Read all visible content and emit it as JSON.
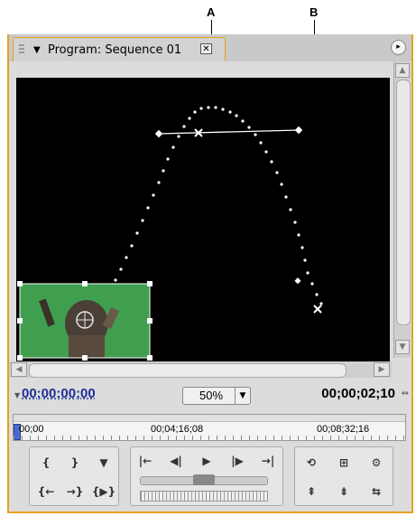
{
  "callouts": {
    "a": "A",
    "b": "B"
  },
  "panel": {
    "tab_title": "Program: Sequence 01",
    "close_glyph": "✕",
    "menu_glyph": "▸"
  },
  "timecode": {
    "current": "00;00;00;00",
    "zoom": "50%",
    "duration": "00;00;02;10"
  },
  "ruler": {
    "labels": [
      "00;00",
      "00;04;16;08",
      "00;08;32;16"
    ]
  },
  "controls": {
    "editing": [
      "{",
      "}",
      "▼",
      "{←",
      "→}",
      "{▶}"
    ],
    "transport": [
      "|←",
      "◀|",
      "▶",
      "|▶",
      "→|"
    ],
    "tools": [
      "⟲",
      "⊞",
      "⚙",
      "⇞",
      "⇟",
      "⇆"
    ]
  },
  "icons": {
    "tab_menu": "triangle-down-icon",
    "close": "close-icon",
    "panel_menu": "panel-menu-icon",
    "scroll_up": "scroll-up-icon",
    "scroll_down": "scroll-down-icon",
    "scroll_left": "scroll-left-icon",
    "scroll_right": "scroll-right-icon",
    "timecode_mode": "timecode-mode-icon"
  },
  "colors": {
    "accent": "#e8a020",
    "timecode_blue": "#1f2f99",
    "video_bg": "#000000",
    "green_screen": "#3f9f4f"
  }
}
